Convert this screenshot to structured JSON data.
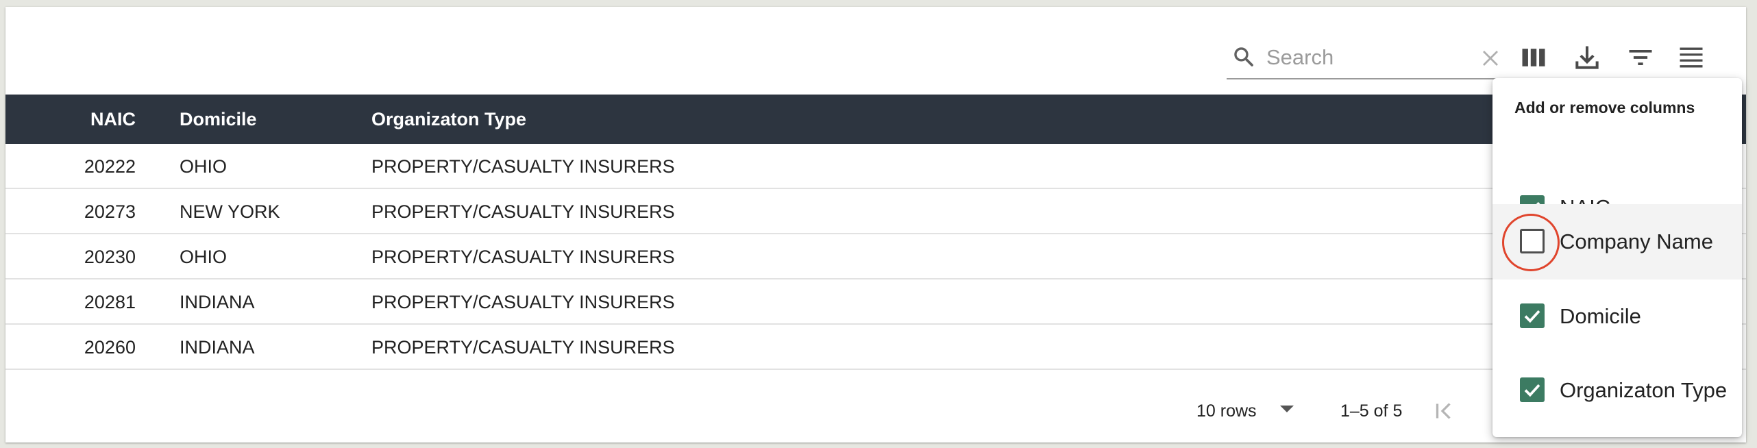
{
  "toolbar": {
    "search_placeholder": "Search",
    "icons": [
      "search-icon",
      "clear-icon",
      "columns-icon",
      "download-icon",
      "filter-icon",
      "density-icon"
    ]
  },
  "table": {
    "columns": [
      "NAIC",
      "Domicile",
      "Organizaton Type"
    ],
    "rows": [
      {
        "naic": "20222",
        "domicile": "OHIO",
        "org_type": "PROPERTY/CASUALTY INSURERS"
      },
      {
        "naic": "20273",
        "domicile": "NEW YORK",
        "org_type": "PROPERTY/CASUALTY INSURERS"
      },
      {
        "naic": "20230",
        "domicile": "OHIO",
        "org_type": "PROPERTY/CASUALTY INSURERS"
      },
      {
        "naic": "20281",
        "domicile": "INDIANA",
        "org_type": "PROPERTY/CASUALTY INSURERS"
      },
      {
        "naic": "20260",
        "domicile": "INDIANA",
        "org_type": "PROPERTY/CASUALTY INSURERS"
      }
    ],
    "header_bg": "#2d3540"
  },
  "pagination": {
    "rows_per_page": "10 rows",
    "range": "1–5 of 5"
  },
  "column_menu": {
    "title": "Add or remove columns",
    "options": [
      {
        "label": "NAIC",
        "checked": true
      },
      {
        "label": "Company Name",
        "checked": false
      },
      {
        "label": "Domicile",
        "checked": true
      },
      {
        "label": "Organizaton Type",
        "checked": true
      }
    ],
    "check_color": "#3c7b62",
    "highlight_color": "#e0452d"
  }
}
